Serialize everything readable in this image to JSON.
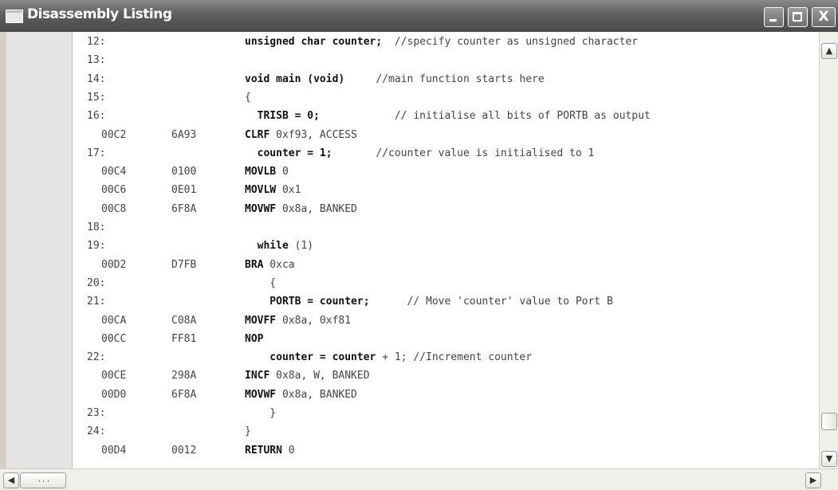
{
  "window": {
    "title": "Disassembly Listing",
    "buttons": {
      "minimize": "minimize",
      "maximize": "maximize",
      "close": "X"
    }
  },
  "lines": [
    {
      "num": "12:",
      "src": [
        {
          "t": "unsigned char counter;",
          "b": true
        },
        {
          "t": "  //specify counter as unsigned character",
          "b": false
        }
      ]
    },
    {
      "num": "13:",
      "src": []
    },
    {
      "num": "14:",
      "src": [
        {
          "t": "void main (void)",
          "b": true
        },
        {
          "t": "     //main function starts here",
          "b": false
        }
      ]
    },
    {
      "num": "15:",
      "src": [
        {
          "t": "{",
          "b": false
        }
      ]
    },
    {
      "num": "16:",
      "src": [
        {
          "t": "  TRISB = 0;",
          "b": true
        },
        {
          "t": "            // initialise all bits of PORTB as output",
          "b": false
        }
      ]
    },
    {
      "addr": "00C2",
      "op": "6A93",
      "src": [
        {
          "t": "CLRF",
          "b": true
        },
        {
          "t": " 0xf93, ACCESS",
          "b": false
        }
      ]
    },
    {
      "num": "17:",
      "src": [
        {
          "t": "  counter = 1;",
          "b": true
        },
        {
          "t": "       //counter value is initialised to 1",
          "b": false
        }
      ]
    },
    {
      "addr": "00C4",
      "op": "0100",
      "src": [
        {
          "t": "MOVLB",
          "b": true
        },
        {
          "t": " 0",
          "b": false
        }
      ]
    },
    {
      "addr": "00C6",
      "op": "0E01",
      "src": [
        {
          "t": "MOVLW",
          "b": true
        },
        {
          "t": " 0x1",
          "b": false
        }
      ]
    },
    {
      "addr": "00C8",
      "op": "6F8A",
      "src": [
        {
          "t": "MOVWF",
          "b": true
        },
        {
          "t": " 0x8a, BANKED",
          "b": false
        }
      ]
    },
    {
      "num": "18:",
      "src": []
    },
    {
      "num": "19:",
      "src": [
        {
          "t": "  while",
          "b": true
        },
        {
          "t": " (1)",
          "b": false
        }
      ]
    },
    {
      "addr": "00D2",
      "op": "D7FB",
      "src": [
        {
          "t": "BRA",
          "b": true
        },
        {
          "t": " 0xca",
          "b": false
        }
      ]
    },
    {
      "num": "20:",
      "src": [
        {
          "t": "    {",
          "b": false
        }
      ]
    },
    {
      "num": "21:",
      "src": [
        {
          "t": "    PORTB = counter;",
          "b": true
        },
        {
          "t": "      // Move 'counter' value to Port B",
          "b": false
        }
      ]
    },
    {
      "addr": "00CA",
      "op": "C08A",
      "src": [
        {
          "t": "MOVFF",
          "b": true
        },
        {
          "t": " 0x8a, 0xf81",
          "b": false
        }
      ]
    },
    {
      "addr": "00CC",
      "op": "FF81",
      "src": [
        {
          "t": "NOP",
          "b": true
        }
      ]
    },
    {
      "num": "22:",
      "src": [
        {
          "t": "    counter = counter",
          "b": true
        },
        {
          "t": " + 1; //Increment counter",
          "b": false
        }
      ]
    },
    {
      "addr": "00CE",
      "op": "298A",
      "src": [
        {
          "t": "INCF",
          "b": true
        },
        {
          "t": " 0x8a, W, BANKED",
          "b": false
        }
      ]
    },
    {
      "addr": "00D0",
      "op": "6F8A",
      "src": [
        {
          "t": "MOVWF",
          "b": true
        },
        {
          "t": " 0x8a, BANKED",
          "b": false
        }
      ]
    },
    {
      "num": "23:",
      "src": [
        {
          "t": "    }",
          "b": false
        }
      ]
    },
    {
      "num": "24:",
      "src": [
        {
          "t": "}",
          "b": false
        }
      ]
    },
    {
      "addr": "00D4",
      "op": "0012",
      "src": [
        {
          "t": "RETURN",
          "b": true
        },
        {
          "t": " 0",
          "b": false
        }
      ]
    }
  ],
  "scrollbars": {
    "up_icon": "chevron-up-icon",
    "down_icon": "chevron-down-icon",
    "left_icon": "chevron-left-icon",
    "right_icon": "chevron-right-icon"
  }
}
